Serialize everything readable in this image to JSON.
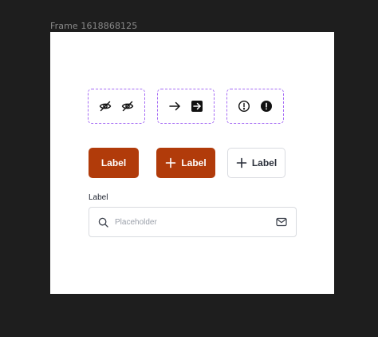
{
  "frame": {
    "title": "Frame 1618868125"
  },
  "icon_variants": [
    {
      "name": "eye-off",
      "icons": [
        "eye-off-outline-icon",
        "eye-off-outline-icon"
      ]
    },
    {
      "name": "arrow-right",
      "icons": [
        "arrow-right-icon",
        "arrow-right-square-filled-icon"
      ]
    },
    {
      "name": "alert-circle",
      "icons": [
        "alert-circle-outline-icon",
        "alert-circle-filled-icon"
      ]
    }
  ],
  "buttons": {
    "primary": {
      "label": "Label"
    },
    "primary_with_icon": {
      "label": "Label",
      "icon": "plus-icon"
    },
    "secondary_with_icon": {
      "label": "Label",
      "icon": "plus-icon"
    }
  },
  "search_field": {
    "label": "Label",
    "placeholder": "Placeholder",
    "value": "",
    "leading_icon": "search-icon",
    "trailing_icon": "mail-icon"
  },
  "colors": {
    "canvas": "#1e1e1e",
    "frame": "#ffffff",
    "accent": "#b13b0a",
    "variant_border": "#a66cf5",
    "border": "#d9dbe0",
    "placeholder": "#9ba0aa"
  }
}
